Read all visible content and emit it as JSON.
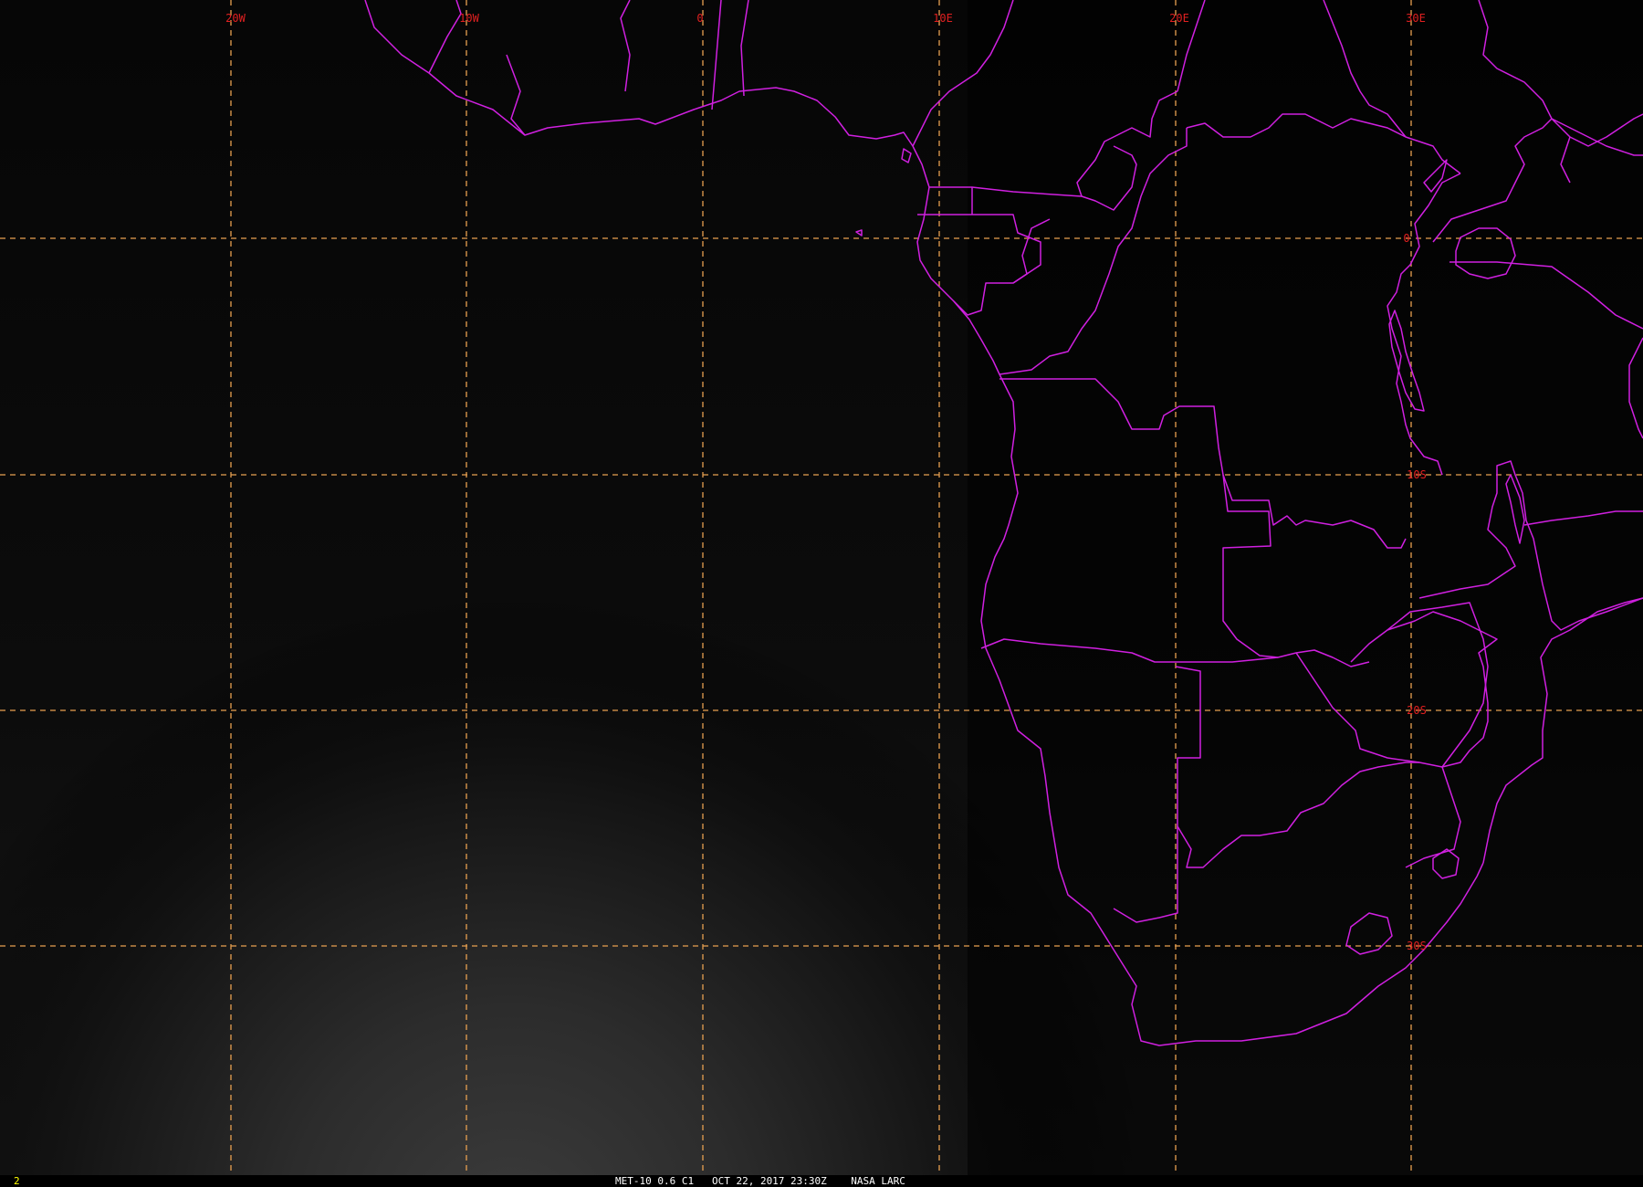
{
  "colors": {
    "background": "#000000",
    "gridline": "#e8a050",
    "grid_label": "#e02020",
    "boundary": "#d020e0",
    "status_text": "#ffffff",
    "frame_number": "#ffff00"
  },
  "grid": {
    "longitude_labels": [
      "20W",
      "10W",
      "0",
      "10E",
      "20E",
      "30E"
    ],
    "latitude_labels": [
      "0",
      "10S",
      "20S",
      "30S"
    ]
  },
  "status_bar": {
    "frame_number": "2",
    "caption": "MET-10 0.6 C1   OCT 22, 2017 23:30Z    NASA LARC"
  },
  "imagery": {
    "satellite": "MET-10",
    "channel": "0.6 C1",
    "region": "South Atlantic / Southern Africa",
    "brightness": "dark night-side with faint glow to the south-west"
  }
}
